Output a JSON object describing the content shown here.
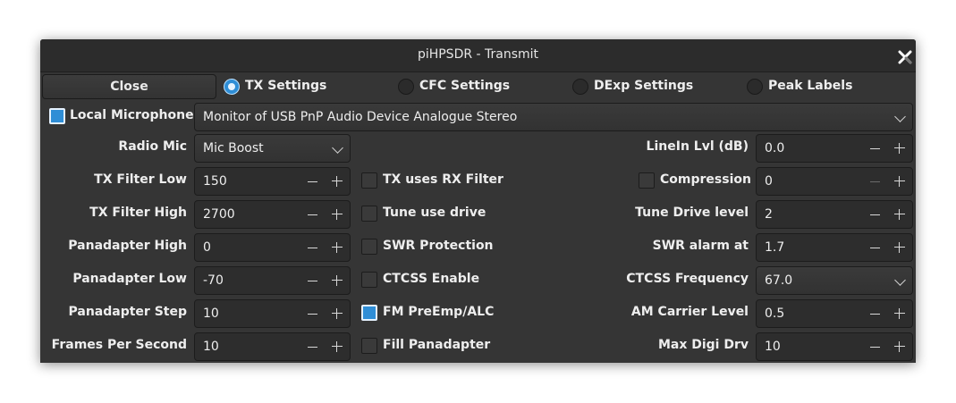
{
  "window": {
    "title": "piHPSDR - Transmit"
  },
  "toolbar": {
    "close_label": "Close",
    "tabs": [
      {
        "label": "TX Settings",
        "selected": true
      },
      {
        "label": "CFC Settings",
        "selected": false
      },
      {
        "label": "DExp Settings",
        "selected": false
      },
      {
        "label": "Peak Labels",
        "selected": false
      }
    ]
  },
  "mic": {
    "local_label": "Local Microphone",
    "local_checked": true,
    "device": "Monitor of USB PnP Audio Device Analogue Stereo"
  },
  "left": {
    "radio_mic_label": "Radio Mic",
    "radio_mic_value": "Mic Boost",
    "rows": [
      {
        "label": "TX Filter Low",
        "value": "150"
      },
      {
        "label": "TX Filter High",
        "value": "2700"
      },
      {
        "label": "Panadapter High",
        "value": "0"
      },
      {
        "label": "Panadapter Low",
        "value": "-70"
      },
      {
        "label": "Panadapter Step",
        "value": "10"
      },
      {
        "label": "Frames Per Second",
        "value": "10"
      }
    ]
  },
  "middle": {
    "checks": [
      {
        "label": "TX uses RX Filter",
        "checked": false
      },
      {
        "label": "Tune use drive",
        "checked": false
      },
      {
        "label": "SWR Protection",
        "checked": false
      },
      {
        "label": "CTCSS Enable",
        "checked": false
      },
      {
        "label": "FM PreEmp/ALC",
        "checked": true
      },
      {
        "label": "Fill Panadapter",
        "checked": false
      }
    ]
  },
  "right": {
    "linein_label": "LineIn Lvl (dB)",
    "linein_value": "0.0",
    "compression_label": "Compression",
    "compression_checked": false,
    "compression_value": "0",
    "tune_drive_label": "Tune Drive level",
    "tune_drive_value": "2",
    "swr_alarm_label": "SWR alarm at",
    "swr_alarm_value": "1.7",
    "ctcss_freq_label": "CTCSS Frequency",
    "ctcss_freq_value": "67.0",
    "am_carrier_label": "AM Carrier Level",
    "am_carrier_value": "0.5",
    "max_digi_label": "Max Digi Drv",
    "max_digi_value": "10"
  },
  "colors": {
    "accent": "#2f8ed6",
    "background": "#353535",
    "titlebar": "#2c2c2c",
    "field": "#2d2d2d"
  },
  "icons": {
    "close": "close-icon",
    "chevron": "chevron-down-icon",
    "minus": "minus-icon",
    "plus": "plus-icon"
  }
}
